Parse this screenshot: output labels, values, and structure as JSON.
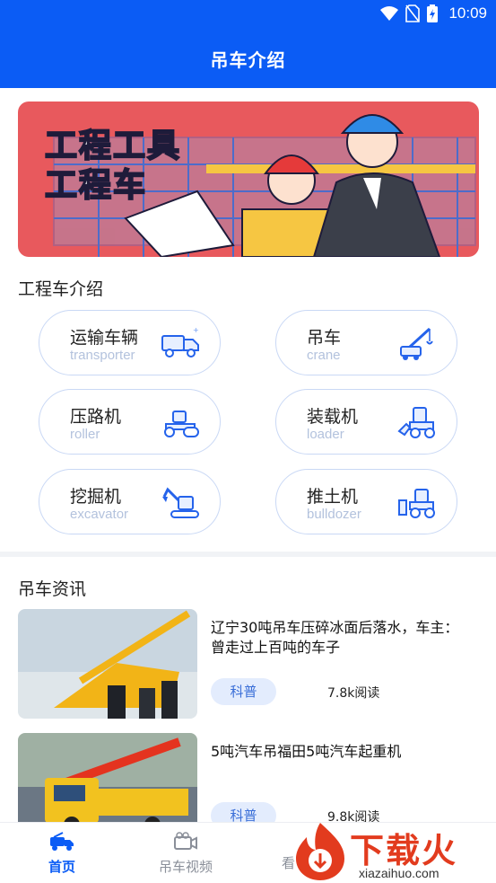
{
  "status_bar": {
    "time": "10:09"
  },
  "app_bar": {
    "title": "吊车介绍"
  },
  "banner": {
    "line1": "工程工具",
    "line2": "工程车"
  },
  "categories_section": {
    "title": "工程车介绍",
    "items": [
      {
        "zh": "运输车辆",
        "en": "transporter",
        "icon": "transporter-icon"
      },
      {
        "zh": "吊车",
        "en": "crane",
        "icon": "crane-icon"
      },
      {
        "zh": "压路机",
        "en": "roller",
        "icon": "roller-icon"
      },
      {
        "zh": "装载机",
        "en": "loader",
        "icon": "loader-icon"
      },
      {
        "zh": "挖掘机",
        "en": "excavator",
        "icon": "excavator-icon"
      },
      {
        "zh": "推土机",
        "en": "bulldozer",
        "icon": "bulldozer-icon"
      }
    ]
  },
  "news_section": {
    "title": "吊车资讯",
    "items": [
      {
        "headline": "辽宁30吨吊车压碎冰面后落水，车主：曾走过上百吨的车子",
        "tag": "科普",
        "reads": "7.8k阅读"
      },
      {
        "headline": "5吨汽车吊福田5吨汽车起重机",
        "tag": "科普",
        "reads": "9.8k阅读"
      }
    ]
  },
  "bottom_nav": {
    "items": [
      {
        "label": "首页",
        "active": true
      },
      {
        "label": "吊车视频",
        "active": false
      },
      {
        "label": "看",
        "active": false
      }
    ]
  },
  "watermark": {
    "brand": "下载火",
    "url": "xiazaihuo.com"
  },
  "colors": {
    "primary": "#0b5cf5",
    "banner_bg": "#e8595d",
    "tag_bg": "#e3ecfd",
    "watermark": "#e23b1e"
  }
}
